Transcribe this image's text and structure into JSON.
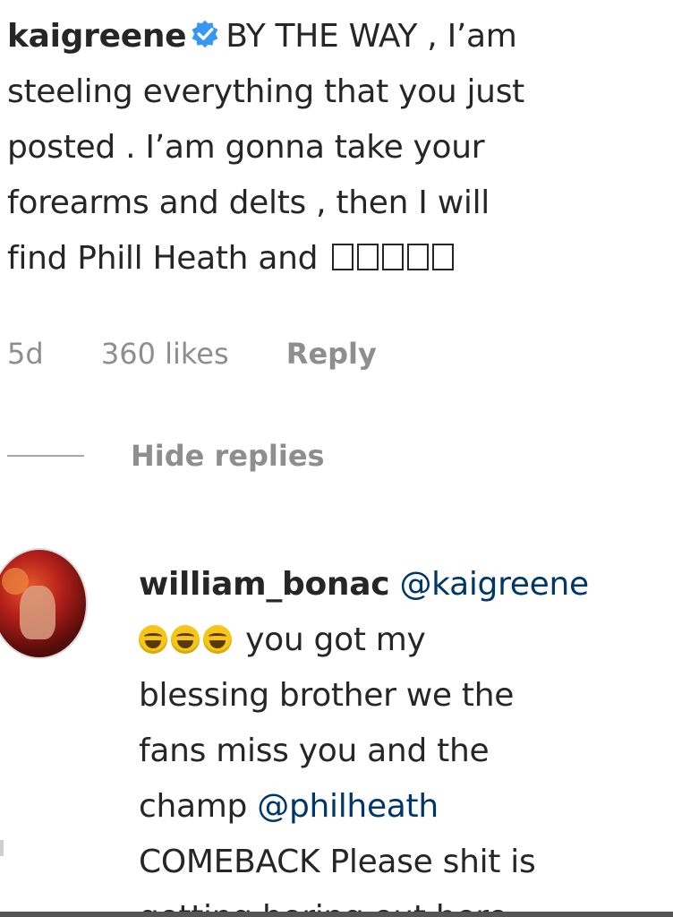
{
  "comment": {
    "username": "kaigreene",
    "lines": [
      "BY THE WAY , I’am",
      "steeling everything that you just",
      "posted . I’am gonna take your",
      "forearms and delts , then I will",
      "find Phill Heath and"
    ],
    "emoji_placeholder_count": 5,
    "time": "5d",
    "likes": "360 likes",
    "reply_label": "Reply"
  },
  "hide_replies_label": "Hide replies",
  "reply": {
    "username": "william_bonac",
    "mention_1": "@kaigreene",
    "emoji": [
      "laughing-emoji",
      "laughing-emoji",
      "laughing-emoji"
    ],
    "text_after_emoji": "you got my",
    "line_3": "blessing brother we the",
    "line_4": "fans miss you and the",
    "line_5_prefix": "champ",
    "mention_2": "@philheath",
    "line_6": "COMEBACK Please shit is",
    "line_7": "getting boring out here"
  },
  "colors": {
    "text": "#262626",
    "secondary": "#8e8e8e",
    "mention": "#00376b",
    "verified": "#3897f0"
  }
}
